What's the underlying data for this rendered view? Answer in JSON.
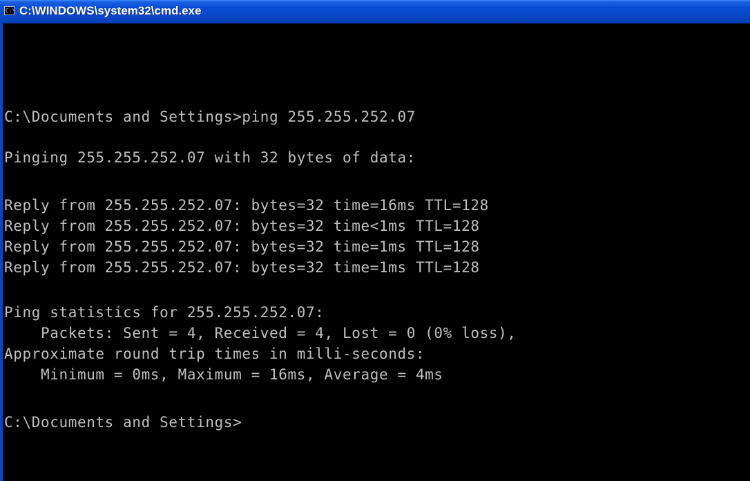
{
  "window": {
    "title": "C:\\WINDOWS\\system32\\cmd.exe",
    "icon": "cmd-icon",
    "icon_glyph": "C:\\"
  },
  "colors": {
    "titlebar": "#0846c8",
    "console_bg": "#000000",
    "console_fg": "#c0c0c0"
  },
  "console": {
    "lines": [
      "C:\\Documents and Settings>ping 255.255.252.07",
      "Pinging 255.255.252.07 with 32 bytes of data:",
      "Reply from 255.255.252.07: bytes=32 time=16ms TTL=128",
      "Reply from 255.255.252.07: bytes=32 time<1ms TTL=128",
      "Reply from 255.255.252.07: bytes=32 time=1ms TTL=128",
      "Reply from 255.255.252.07: bytes=32 time=1ms TTL=128",
      "Ping statistics for 255.255.252.07:",
      "    Packets: Sent = 4, Received = 4, Lost = 0 (0% loss),",
      "Approximate round trip times in milli-seconds:",
      "    Minimum = 0ms, Maximum = 16ms, Average = 4ms",
      "C:\\Documents and Settings>"
    ]
  }
}
